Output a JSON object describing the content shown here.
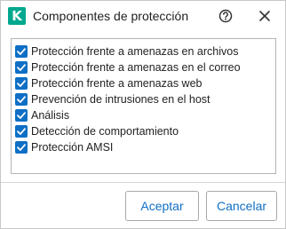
{
  "colors": {
    "brand": "#00a88e",
    "accent": "#0f6fc6",
    "checkbox": "#0f6fc6"
  },
  "dialog": {
    "logo_letter": "K",
    "title": "Componentes de protección",
    "help_icon": "help-circle-icon",
    "close_icon": "close-icon"
  },
  "components": [
    {
      "label": "Protección frente a amenazas en archivos",
      "checked": true
    },
    {
      "label": "Protección frente a amenazas en el correo",
      "checked": true
    },
    {
      "label": "Protección frente a amenazas web",
      "checked": true
    },
    {
      "label": "Prevención de intrusiones en el host",
      "checked": true
    },
    {
      "label": "Análisis",
      "checked": true
    },
    {
      "label": "Detección de comportamiento",
      "checked": true
    },
    {
      "label": "Protección AMSI",
      "checked": true
    }
  ],
  "buttons": {
    "accept": "Aceptar",
    "cancel": "Cancelar"
  }
}
